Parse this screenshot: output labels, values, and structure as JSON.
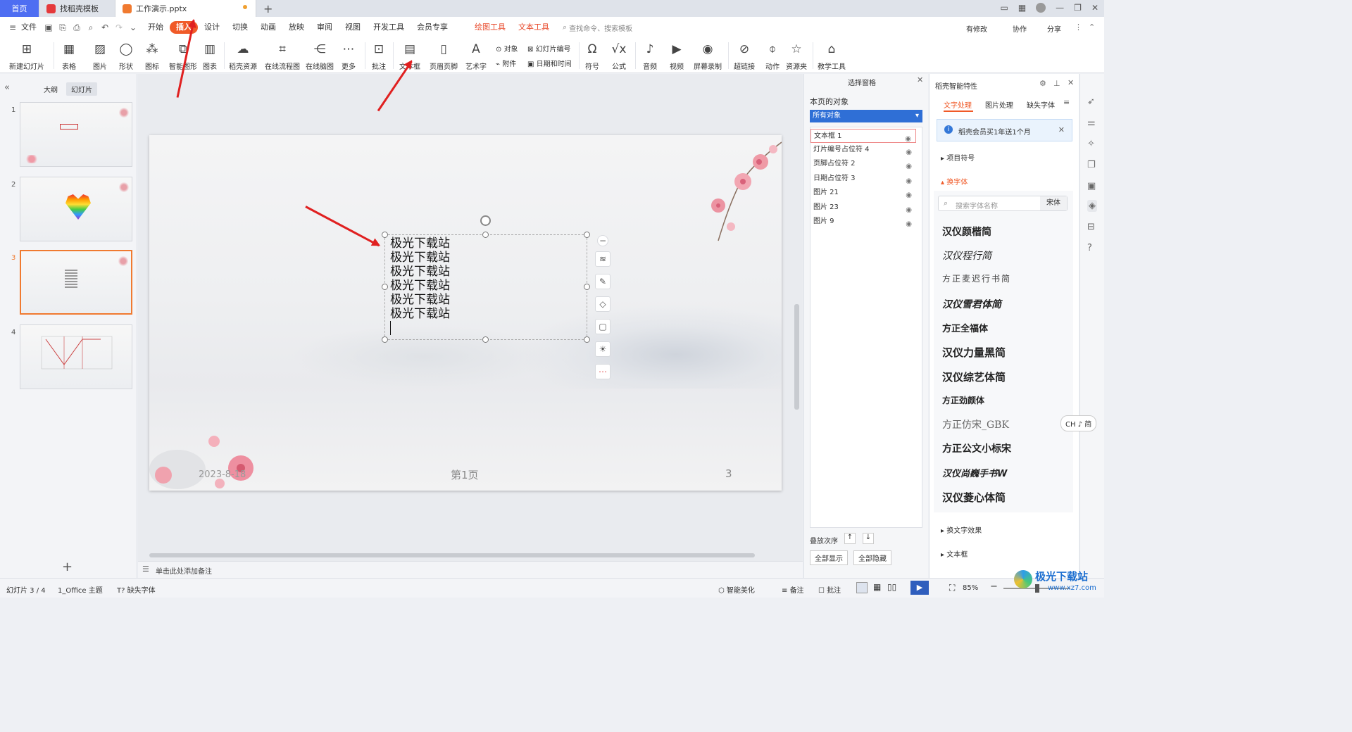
{
  "tabs": {
    "home": "首页",
    "template": "找稻壳模板",
    "document": "工作演示.pptx",
    "new_tab": "+"
  },
  "menubar": {
    "file": "文件",
    "items": [
      "开始",
      "插入",
      "设计",
      "切换",
      "动画",
      "放映",
      "审阅",
      "视图",
      "开发工具",
      "会员专享"
    ],
    "active": "插入",
    "tool_items": [
      "绘图工具",
      "文本工具"
    ],
    "search_placeholder": "查找命令、搜索模板",
    "right": [
      "有修改",
      "协作",
      "分享"
    ]
  },
  "ribbon": {
    "new_slide": "新建幻灯片",
    "table": "表格",
    "picture": "图片",
    "shape": "形状",
    "icon": "图标",
    "smart_graphic": "智能图形",
    "chart": "图表",
    "docer_resources": "稻壳资源",
    "online_flowchart": "在线流程图",
    "online_mindmap": "在线脑图",
    "more": "更多",
    "comment": "批注",
    "textbox": "文本框",
    "header_footer": "页眉页脚",
    "wordart": "艺术字",
    "object": "对象",
    "attachment": "附件",
    "slide_number": "幻灯片编号",
    "date_time": "日期和时间",
    "symbol": "符号",
    "formula": "公式",
    "audio": "音频",
    "video": "视频",
    "screen_record": "屏幕录制",
    "hyperlink": "超链接",
    "action": "动作",
    "resource_folder": "资源夹",
    "teaching_tools": "教学工具"
  },
  "leftpanel": {
    "tab_outline": "大纲",
    "tab_slides": "幻灯片",
    "slide_numbers": [
      "1",
      "2",
      "3",
      "4"
    ],
    "add": "+"
  },
  "slide": {
    "text_lines": [
      "极光下载站",
      "极光下载站",
      "极光下载站",
      "极光下载站",
      "极光下载站",
      "极光下载站"
    ],
    "date": "2023-8-18",
    "page_label": "第1页",
    "slide_num": "3"
  },
  "notes_placeholder": "单击此处添加备注",
  "selection_pane": {
    "title": "选择窗格",
    "section": "本页的对象",
    "filter": "所有对象",
    "objects": [
      "文本框 1",
      "灯片编号占位符 4",
      "页脚占位符 2",
      "日期占位符 3",
      "图片 21",
      "图片 23",
      "图片 9"
    ],
    "order_label": "叠放次序",
    "show_all": "全部显示",
    "hide_all": "全部隐藏"
  },
  "right_panel": {
    "title": "稻壳智能特性",
    "tabs": [
      "文字处理",
      "图片处理",
      "缺失字体"
    ],
    "promo": "稻壳会员买1年送1个月",
    "bullets": "项目符号",
    "change_font": "换字体",
    "font_search_placeholder": "搜索字体名称",
    "current_font": "宋体",
    "fonts": [
      "汉仪颜楷简",
      "汉仪程行简",
      "方正麦迟行书简",
      "汉仪雪君体简",
      "方正全福体",
      "汉仪力量黑简",
      "汉仪综艺体简",
      "方正劲颜体",
      "方正仿宋_GBK",
      "方正公文小标宋",
      "汉仪尚巍手书W",
      "汉仪菱心体简"
    ],
    "text_effect": "换文字效果",
    "textbox": "文本框",
    "ime": "CH ♪ 简"
  },
  "statusbar": {
    "slide_info": "幻灯片 3 / 4",
    "theme": "1_Office 主题",
    "missing_font": "缺失字体",
    "smart_beautify": "智能美化",
    "notes": "备注",
    "comments": "批注",
    "zoom": "85%"
  },
  "watermark": "极光下载站",
  "watermark_url": "www.xz7.com",
  "colors": {
    "accent": "#f05a28",
    "arrow": "#e02020",
    "home_tab": "#4e6ef2",
    "filter_bg": "#2f6fd6"
  }
}
